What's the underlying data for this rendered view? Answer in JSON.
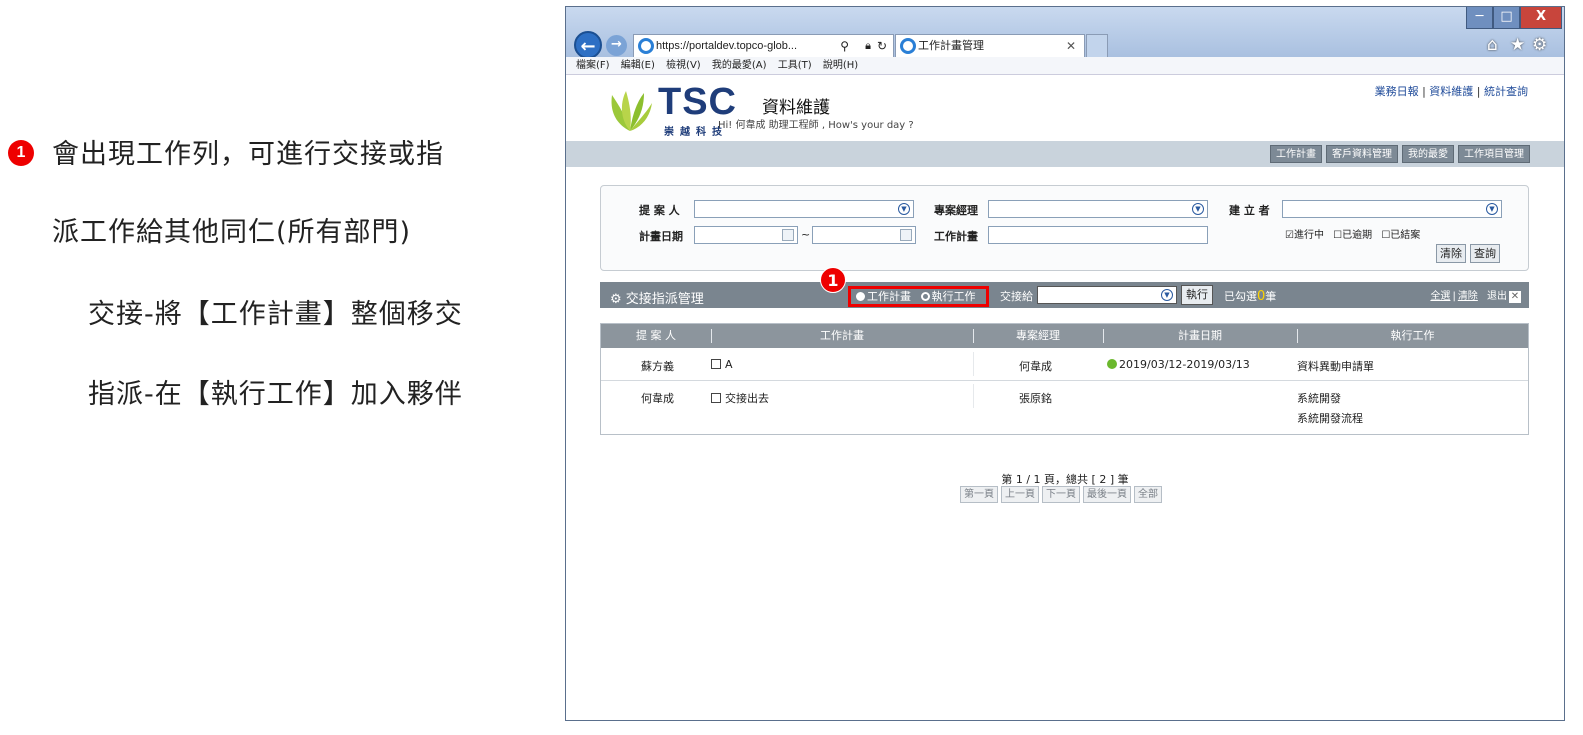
{
  "annotation": {
    "badge": "1",
    "line1": "會出現工作列，可進行交接或指",
    "line2": "派工作給其他同仁(所有部門)",
    "line3": "交接-將【工作計畫】整個移交",
    "line4": "指派-在【執行工作】加入夥伴"
  },
  "browser": {
    "url": "https://portaldev.topco-glob...",
    "tab_title": "工作計畫管理",
    "menu": [
      "檔案(F)",
      "編輯(E)",
      "檢視(V)",
      "我的最愛(A)",
      "工具(T)",
      "說明(H)"
    ],
    "win_min": "─",
    "win_max": "□",
    "win_close": "X"
  },
  "header": {
    "logo_text": "TSC",
    "logo_sub": "崇越科技",
    "site_title": "資料維護",
    "greeting": "Hi! 何韋成 助理工程師 , How's your day ?",
    "links": [
      "業務日報",
      "資料維護",
      "統計查詢"
    ],
    "nav": [
      "工作計畫",
      "客戶資料管理",
      "我的最愛",
      "工作項目管理"
    ]
  },
  "search": {
    "proposer_label": "提 案 人",
    "pm_label": "專案經理",
    "creator_label": "建 立 者",
    "date_label": "計畫日期",
    "date_sep": "~",
    "plan_label": "工作計畫",
    "status_options": [
      {
        "label": "進行中",
        "checked": true
      },
      {
        "label": "已逾期",
        "checked": false
      },
      {
        "label": "已結案",
        "checked": false
      }
    ],
    "clear_button": "清除",
    "query_button": "查詢"
  },
  "handover": {
    "title": "交接指派管理",
    "badge": "1",
    "radio_plan": "工作計畫",
    "radio_task": "執行工作",
    "selected": "工作計畫",
    "assign_label": "交接給",
    "assign_value": "",
    "exec_button": "執行",
    "count_prefix": "已勾選",
    "count": "0",
    "count_suffix": "筆",
    "select_all": "全選",
    "clear": "清除",
    "exit": "退出"
  },
  "table": {
    "columns": [
      "提 案 人",
      "工作計畫",
      "專案經理",
      "計畫日期",
      "執行工作"
    ],
    "rows": [
      {
        "proposer": "蘇方義",
        "plan": "A",
        "pm": "何韋成",
        "date": "2019/03/12-2019/03/13",
        "tasks": [
          "資料異動申請單"
        ]
      },
      {
        "proposer": "何韋成",
        "plan": "交接出去",
        "pm": "張原銘",
        "date": "",
        "tasks": [
          "系統開發",
          "系統開發流程"
        ]
      }
    ]
  },
  "pager": {
    "info": "第 1 / 1 頁，總共 [ 2 ] 筆",
    "buttons": [
      "第一頁",
      "上一頁",
      "下一頁",
      "最後一頁",
      "全部"
    ]
  }
}
